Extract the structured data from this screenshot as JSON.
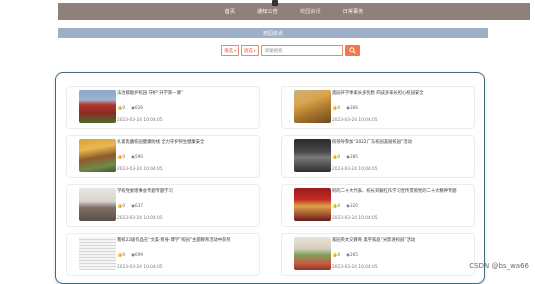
{
  "nav": {
    "items": [
      {
        "label": "首页"
      },
      {
        "label": "通知公告"
      },
      {
        "label": "校园资讯"
      },
      {
        "label": "日常事务"
      }
    ]
  },
  "section": {
    "title": "校园资讯"
  },
  "search": {
    "select1": "请选",
    "select2": "请选",
    "placeholder": "请输搜索"
  },
  "news": [
    {
      "title": "法治赋能护校园 守护“开学第一课”",
      "likes": "0",
      "views": "626",
      "date": "2023-03-24 10:04:05"
    },
    {
      "title": "奥园开学季家长多忧愁 四成多家长担心校园安全",
      "likes": "0",
      "views": "366",
      "date": "2023-03-24 10:04:05"
    },
    {
      "title": "扎紧乳酸校园健康防线 全力守护师生健康安全",
      "likes": "0",
      "views": "590",
      "date": "2023-03-24 10:04:05"
    },
    {
      "title": "校领导参加“2022广东校园美丽校园”活动",
      "likes": "0",
      "views": "385",
      "date": "2023-03-24 10:04:05"
    },
    {
      "title": "学校党委理事会专题专题学习",
      "likes": "0",
      "views": "637",
      "date": "2023-03-24 10:04:05"
    },
    {
      "title": "阿的二十大代表、校长刘颖红作学习宣传贯彻党的二十大精神专题",
      "likes": "0",
      "views": "320",
      "date": "2023-03-24 10:04:05"
    },
    {
      "title": "我校22级作品在“文美·修身·博学”校园”主题教育活动中获奖",
      "likes": "0",
      "views": "699",
      "date": "2023-03-24 10:04:05"
    },
    {
      "title": "家园英文交教育 奥宇家庭“光影进校园”活动",
      "likes": "0",
      "views": "265",
      "date": "2023-03-24 10:04:05"
    }
  ],
  "colors": {
    "nav_bg": "#8f8079",
    "section_bg": "#9eb0c8",
    "accent": "#f07a4c",
    "panel_border": "#3f6a79"
  },
  "watermark": "CSDN @bs_wa66"
}
